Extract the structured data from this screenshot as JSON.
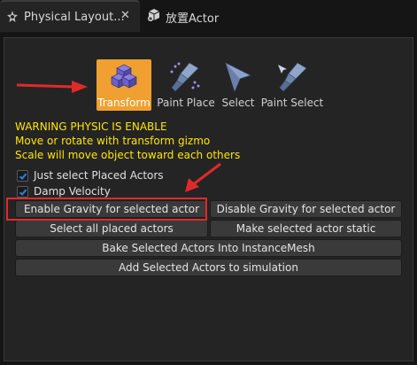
{
  "tabs": [
    {
      "label": "Physical Layout...",
      "close": "✕",
      "icon": "gear-star-icon"
    },
    {
      "label": "放置Actor",
      "icon": "add-actor-icon"
    }
  ],
  "modes": [
    {
      "label": "Transform",
      "icon": "transform-cubes-icon",
      "active": true
    },
    {
      "label": "Paint Place",
      "icon": "paint-place-icon"
    },
    {
      "label": "Select",
      "icon": "cursor-arrow-icon"
    },
    {
      "label": "Paint Select",
      "icon": "paint-select-icon"
    }
  ],
  "warning": {
    "line1": "WARNING PHYSIC IS ENABLE",
    "line2": "Move or rotate with transform gizmo",
    "line3": "Scale will move object toward each others"
  },
  "checkboxes": [
    {
      "label": "Just select Placed Actors",
      "checked": true
    },
    {
      "label": "Damp Velocity",
      "checked": true
    }
  ],
  "buttons": {
    "enable_gravity": "Enable Gravity for selected actor",
    "disable_gravity": "Disable Gravity for selected actor",
    "select_all": "Select all placed actors",
    "make_static": "Make selected actor static",
    "bake": "Bake Selected Actors Into InstanceMesh",
    "add_sim": "Add Selected Actors to simulation"
  },
  "colors": {
    "accent": "#f0a030",
    "warning_text": "#ffe600",
    "annotation_red": "#e02a2a",
    "checkbox_blue": "#2f7fe0"
  }
}
